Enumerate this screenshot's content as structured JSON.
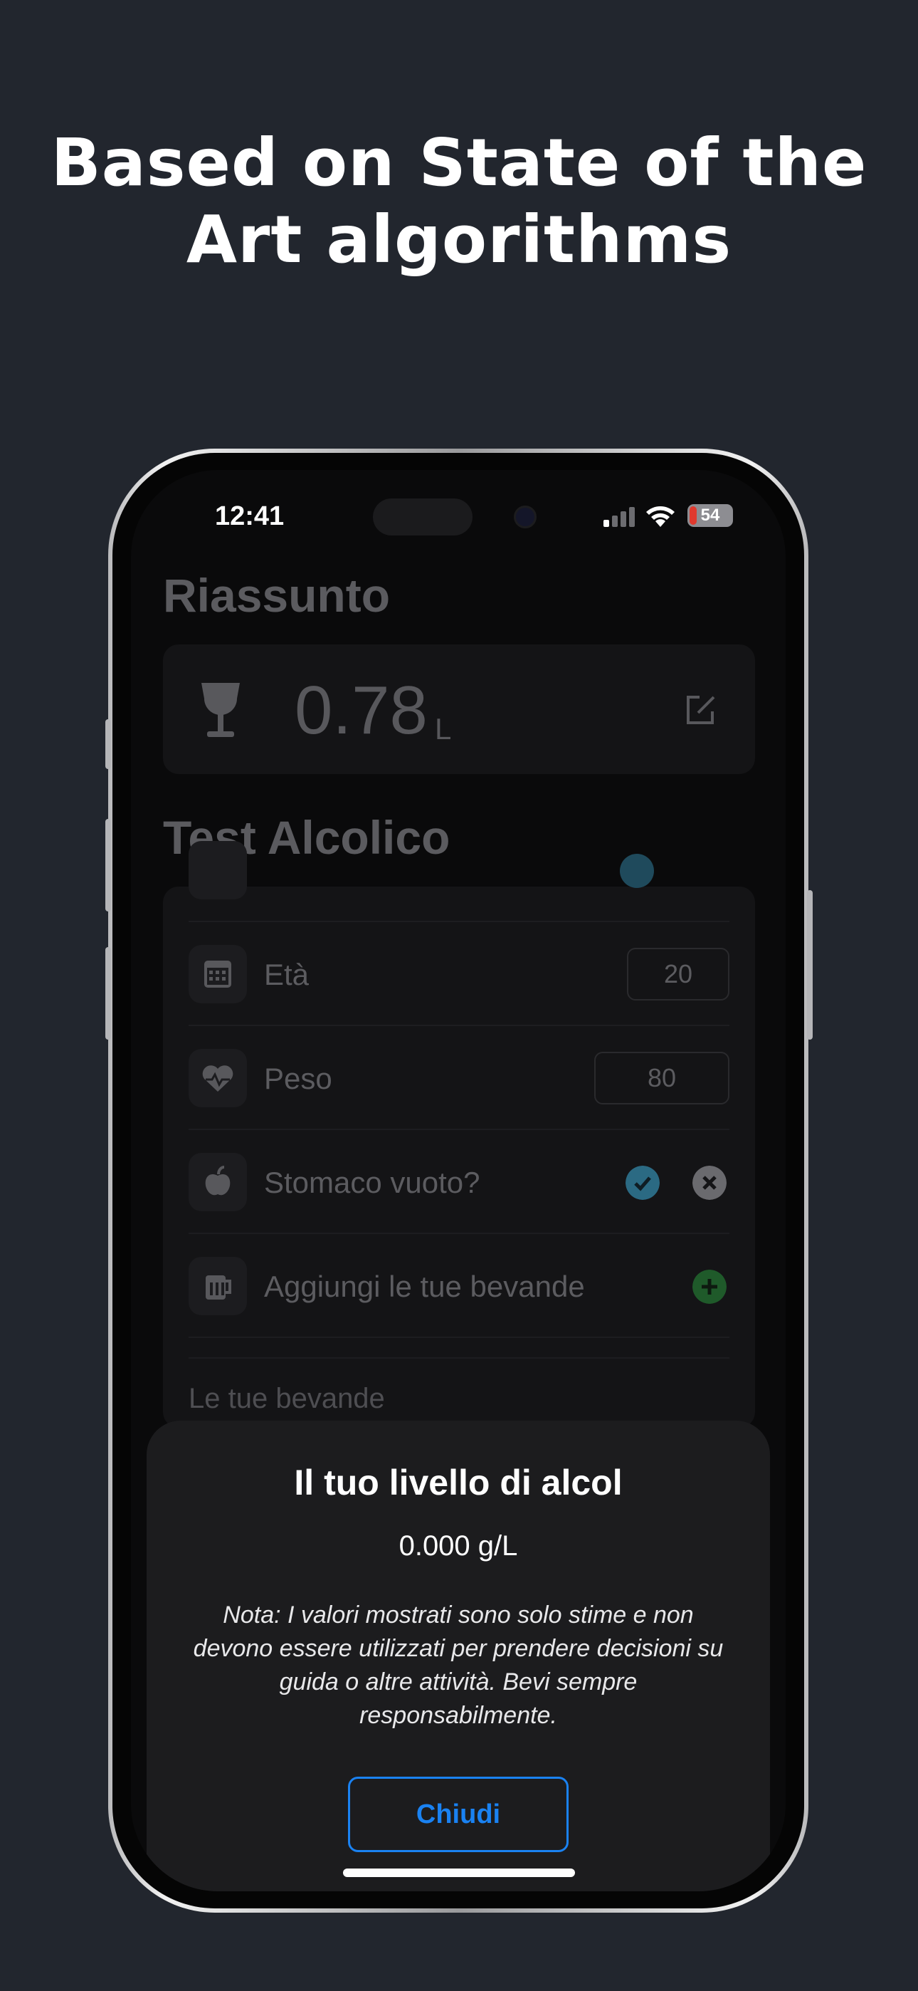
{
  "headline": {
    "line1": "Based on State of the",
    "line2": "Art algorithms"
  },
  "status_bar": {
    "time": "12:41",
    "battery": "54"
  },
  "summary": {
    "title": "Riassunto",
    "value": "0.78",
    "unit": "L",
    "icon": "wine-glass-icon",
    "edit_icon": "edit-icon"
  },
  "test": {
    "title": "Test Alcolico",
    "rows": [
      {
        "label": "Età",
        "value": "20",
        "icon": "calendar-icon"
      },
      {
        "label": "Peso",
        "value": "80",
        "icon": "heart-pulse-icon"
      },
      {
        "label": "Stomaco vuoto?",
        "icon": "apple-icon"
      },
      {
        "label": "Aggiungi le tue bevande",
        "icon": "beer-mug-icon"
      }
    ],
    "drinks_label": "Le tue bevande"
  },
  "modal": {
    "title": "Il tuo livello di alcol",
    "value": "0.000 g/L",
    "note": "Nota: I valori mostrati sono solo stime e non devono essere utilizzati per prendere decisioni su guida o altre attività. Bevi sempre responsabilmente.",
    "close_label": "Chiudi"
  },
  "colors": {
    "background": "#22262e",
    "accent": "#1a82f2",
    "check": "#2f8fb0",
    "add": "#3fa34d"
  }
}
